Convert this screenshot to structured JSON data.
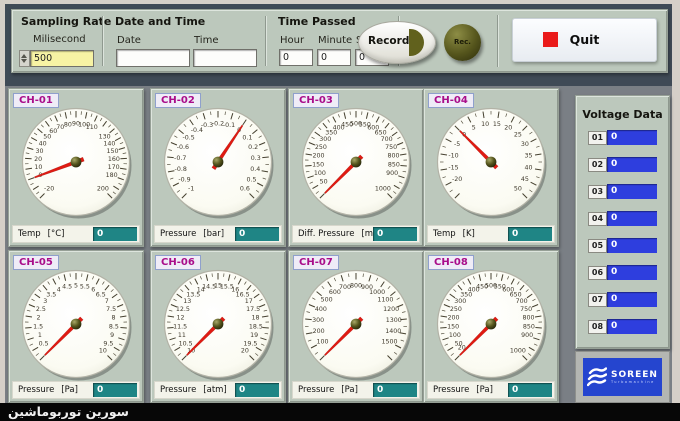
{
  "header": {
    "sampling": {
      "title": "Sampling Rate",
      "field_label": "Milisecond",
      "value": "500"
    },
    "datetime": {
      "title": "Date and Time",
      "date_label": "Date",
      "time_label": "Time",
      "date_value": "",
      "time_value": ""
    },
    "time_passed": {
      "title": "Time Passed",
      "fields": [
        {
          "label": "Hour",
          "value": "0"
        },
        {
          "label": "Minute",
          "value": "0"
        },
        {
          "label": "Second",
          "value": "0"
        }
      ]
    },
    "record_label": "Record",
    "rec_label": "Rec.",
    "quit_label": "Quit"
  },
  "colors": {
    "needle": "#e01a12",
    "display_teal": "#1f8585",
    "voltage_blue": "#2e3ede",
    "panel_sage": "#bcc8bc",
    "quit_red": "#ea1a1a",
    "logo_blue": "#2545cf"
  },
  "channels": [
    {
      "id": "CH-01",
      "label": "Temp",
      "unit": "[°C]",
      "display": "0",
      "gauge": {
        "min": -20,
        "max": 200,
        "step": 10,
        "value": 0,
        "labels": [
          "-20",
          "0",
          "10",
          "20",
          "30",
          "40",
          "50",
          "60",
          "70",
          "80",
          "90",
          "100",
          "110",
          "130",
          "140",
          "150",
          "160",
          "170",
          "180",
          "200"
        ]
      }
    },
    {
      "id": "CH-02",
      "label": "Pressure",
      "unit": "[bar]",
      "display": "0",
      "gauge": {
        "min": -1,
        "max": 0.6,
        "step": 0.1,
        "value": 0,
        "labels": [
          "-1",
          "-0.9",
          "-0.8",
          "-0.7",
          "-0.6",
          "-0.5",
          "-0.4",
          "-0.3",
          "-0.2",
          "-0.1",
          "0",
          "0.1",
          "0.2",
          "0.3",
          "0.4",
          "0.5",
          "0.6"
        ]
      }
    },
    {
      "id": "CH-03",
      "label": "Diff. Pressure",
      "unit": "[mbar]",
      "display": "0",
      "gauge": {
        "min": 0,
        "max": 1000,
        "step": 50,
        "value": 0,
        "labels": [
          "50",
          "100",
          "150",
          "200",
          "250",
          "300",
          "350",
          "400",
          "450",
          "500",
          "550",
          "600",
          "650",
          "700",
          "750",
          "800",
          "850",
          "900",
          "1000"
        ]
      }
    },
    {
      "id": "CH-04",
      "label": "Temp",
      "unit": "[K]",
      "display": "0",
      "gauge": {
        "min": -25,
        "max": 50,
        "step": 5,
        "value": 0,
        "labels": [
          "-20",
          "-15",
          "-10",
          "-5",
          "0",
          "5",
          "10",
          "15",
          "20",
          "25",
          "30",
          "35",
          "40",
          "45",
          "50"
        ]
      }
    },
    {
      "id": "CH-05",
      "label": "Pressure",
      "unit": "[Pa]",
      "display": "0",
      "gauge": {
        "min": 0,
        "max": 10,
        "step": 0.5,
        "value": 0,
        "labels": [
          "0.5",
          "1",
          "1.5",
          "2",
          "2.5",
          "3",
          "3.5",
          "4",
          "4.5",
          "5",
          "5.5",
          "6",
          "6.5",
          "7",
          "7.5",
          "8",
          "8.5",
          "9",
          "9.5",
          "10"
        ]
      }
    },
    {
      "id": "CH-06",
      "label": "Pressure",
      "unit": "[atm]",
      "display": "0",
      "gauge": {
        "min": 10,
        "max": 20,
        "step": 0.5,
        "value": 0,
        "labels": [
          "10",
          "10.5",
          "11",
          "11.5",
          "12",
          "12.5",
          "13",
          "13.5",
          "14",
          "14.5",
          "15",
          "15.5",
          "16",
          "16.5",
          "17",
          "17.5",
          "18",
          "18.5",
          "19",
          "19.5",
          "20"
        ]
      }
    },
    {
      "id": "CH-07",
      "label": "Pressure",
      "unit": "[Pa]",
      "display": "0",
      "gauge": {
        "min": 0,
        "max": 1600,
        "step": 100,
        "value": 0,
        "labels": [
          "100",
          "200",
          "300",
          "400",
          "500",
          "600",
          "700",
          "800",
          "900",
          "1000",
          "1100",
          "1200",
          "1300",
          "1400",
          "1500"
        ]
      }
    },
    {
      "id": "CH-08",
      "label": "Pressure",
      "unit": "[Pa]",
      "display": "0",
      "gauge": {
        "min": 0,
        "max": 1000,
        "step": 50,
        "value": 0,
        "labels": [
          "20",
          "50",
          "100",
          "150",
          "200",
          "250",
          "300",
          "350",
          "400",
          "450",
          "500",
          "550",
          "600",
          "650",
          "700",
          "750",
          "800",
          "850",
          "900",
          "1000"
        ]
      }
    }
  ],
  "voltage_panel": {
    "title": "Voltage Data",
    "rows": [
      {
        "index": "01",
        "value": "0"
      },
      {
        "index": "02",
        "value": "0"
      },
      {
        "index": "03",
        "value": "0"
      },
      {
        "index": "04",
        "value": "0"
      },
      {
        "index": "05",
        "value": "0"
      },
      {
        "index": "06",
        "value": "0"
      },
      {
        "index": "07",
        "value": "0"
      },
      {
        "index": "08",
        "value": "0"
      }
    ]
  },
  "logo": {
    "brand": "SOREEN",
    "sub": "Turbomachine"
  },
  "taskbar": {
    "title": "سورین توربوماشین"
  }
}
